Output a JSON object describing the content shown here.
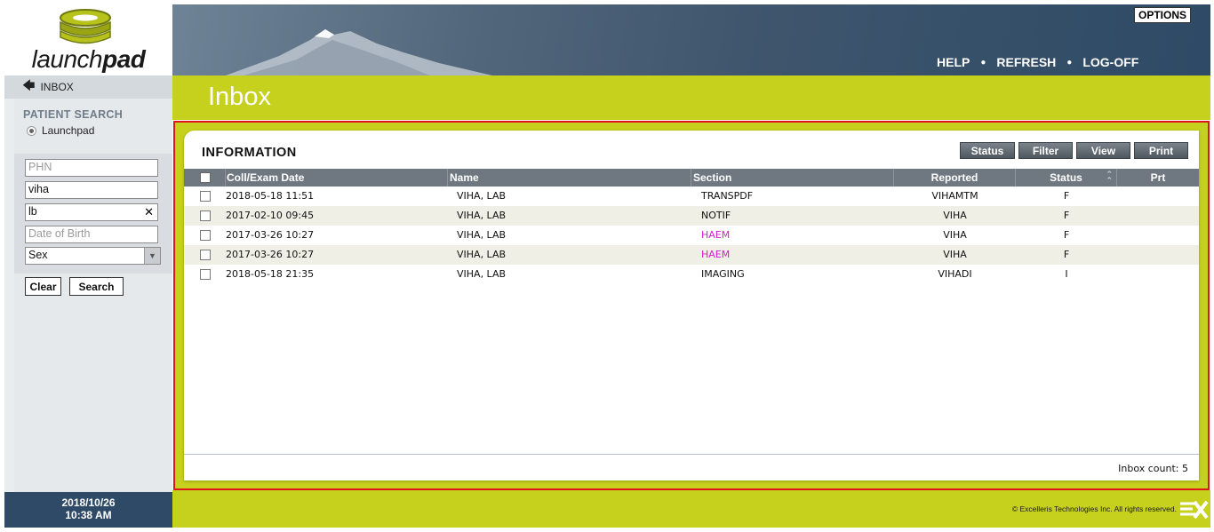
{
  "brand": {
    "logo_text_light": "launch",
    "logo_text_bold": "pad"
  },
  "header": {
    "options_label": "OPTIONS",
    "links": [
      "HELP",
      "REFRESH",
      "LOG-OFF"
    ],
    "separator": "●"
  },
  "sidebar": {
    "inbox_label": "INBOX",
    "search_title": "PATIENT SEARCH",
    "source_option": "Launchpad",
    "fields": {
      "phn_placeholder": "PHN",
      "last_name_value": "viha",
      "first_name_value": "lb",
      "dob_placeholder": "Date of Birth",
      "sex_value": "Sex"
    },
    "clear_label": "Clear",
    "search_label": "Search",
    "date": "2018/10/26",
    "time": "10:38 AM"
  },
  "page": {
    "title": "Inbox"
  },
  "panel": {
    "title": "INFORMATION",
    "buttons": [
      "Status",
      "Filter",
      "View",
      "Print"
    ],
    "columns": [
      "Coll/Exam Date",
      "Name",
      "Section",
      "Reported",
      "Status",
      "Prt"
    ],
    "rows": [
      {
        "date": "2018-05-18 11:51",
        "name": "VIHA, LAB",
        "section": "TRANSPDF",
        "reported": "VIHAMTM",
        "status": "F",
        "highlight": false
      },
      {
        "date": "2017-02-10 09:45",
        "name": "VIHA, LAB",
        "section": "NOTIF",
        "reported": "VIHA",
        "status": "F",
        "highlight": false
      },
      {
        "date": "2017-03-26 10:27",
        "name": "VIHA, LAB",
        "section": "HAEM",
        "reported": "VIHA",
        "status": "F",
        "highlight": true
      },
      {
        "date": "2017-03-26 10:27",
        "name": "VIHA, LAB",
        "section": "HAEM",
        "reported": "VIHA",
        "status": "F",
        "highlight": true
      },
      {
        "date": "2018-05-18 21:35",
        "name": "VIHA, LAB",
        "section": "IMAGING",
        "reported": "VIHADI",
        "status": "I",
        "highlight": false
      }
    ],
    "inbox_count": "Inbox count: 5"
  },
  "footer": {
    "copyright": "© Excelleris Technologies Inc. All rights reserved."
  },
  "colors": {
    "accent": "#c5d11c",
    "highlight_text": "#d020c8",
    "header_dark": "#2e4a66",
    "outline": "#e0141b"
  }
}
